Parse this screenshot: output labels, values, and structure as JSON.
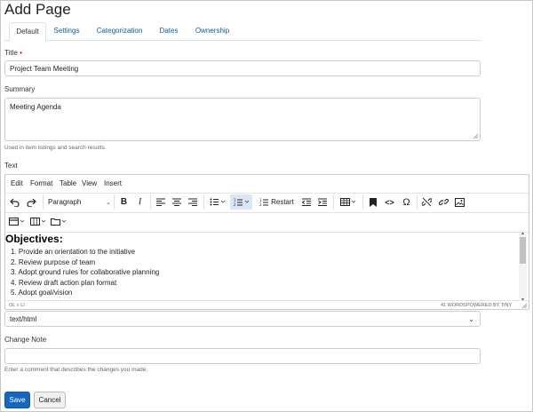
{
  "page": {
    "title": "Add Page"
  },
  "tabs": [
    "Default",
    "Settings",
    "Categorization",
    "Dates",
    "Ownership"
  ],
  "fields": {
    "title_label": "Title",
    "title_required": "•",
    "title_value": "Project Team Meeting",
    "summary_label": "Summary",
    "summary_value": "Meeting Agenda",
    "summary_help": "Used in item listings and search results.",
    "text_label": "Text",
    "format_value": "text/html",
    "change_note_label": "Change Note",
    "change_note_value": "",
    "change_note_help": "Enter a comment that describes the changes you made."
  },
  "editor": {
    "menu": [
      "Edit",
      "Format",
      "Table",
      "View",
      "Insert"
    ],
    "block_format": "Paragraph",
    "restart_label": "Restart",
    "content_heading": "Objectives:",
    "content_list": [
      "1. Provide an orientation to the initiative",
      "2. Review purpose of team",
      "3. Adopt ground rules for collaborative planning",
      "4. Review draft action plan format",
      "5. Adopt goal/vision"
    ],
    "path": "OL » LI",
    "word_count": "41 WORDS",
    "powered_by": "POWERED BY TINY"
  },
  "buttons": {
    "save": "Save",
    "cancel": "Cancel"
  },
  "colors": {
    "link": "#0b5fa5",
    "primary": "#1566c0",
    "required": "#cc0000"
  }
}
